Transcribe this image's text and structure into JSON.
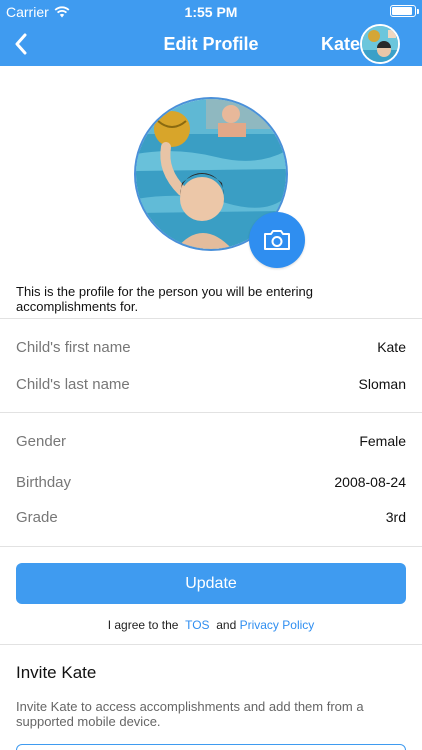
{
  "status_bar": {
    "carrier": "Carrier",
    "time": "1:55 PM",
    "battery_level": 0.95
  },
  "nav": {
    "title": "Edit Profile",
    "user_name": "Kate"
  },
  "profile": {
    "description": "This is the profile for the person you will be entering accomplishments for."
  },
  "fields": [
    {
      "label": "Child's first name",
      "value": "Kate"
    },
    {
      "label": "Child's last name",
      "value": "Sloman"
    },
    {
      "label": "Gender",
      "value": "Female"
    },
    {
      "label": "Birthday",
      "value": "2008-08-24"
    },
    {
      "label": "Grade",
      "value": "3rd"
    }
  ],
  "update_label": "Update",
  "agree": {
    "prefix": "I agree to the",
    "tos": "TOS",
    "and": "and",
    "privacy": "Privacy Policy"
  },
  "invite": {
    "title": "Invite Kate",
    "description": "Invite Kate to access accomplishments and add them from a supported mobile device."
  },
  "colors": {
    "accent": "#3f9bf0",
    "button": "#2f8ef0"
  }
}
